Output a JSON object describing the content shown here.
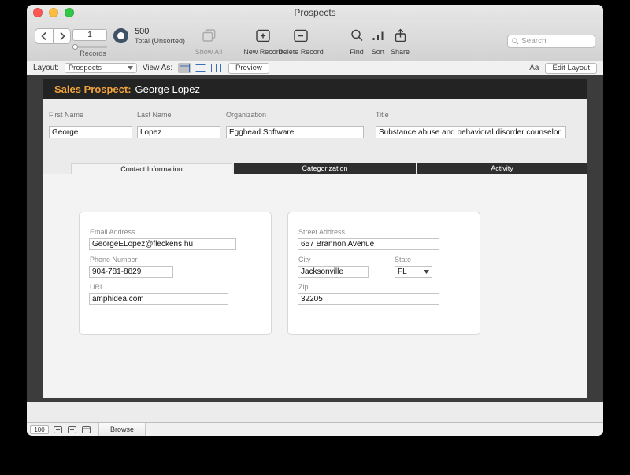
{
  "window": {
    "title": "Prospects"
  },
  "toolbar": {
    "current_record": "1",
    "total_count": "500",
    "total_label": "Total (Unsorted)",
    "records_label": "Records",
    "buttons": {
      "show_all": "Show All",
      "new_record": "New Record",
      "delete_record": "Delete Record",
      "find": "Find",
      "sort": "Sort",
      "share": "Share"
    },
    "search_placeholder": "Search"
  },
  "layout_bar": {
    "layout_label": "Layout:",
    "layout_value": "Prospects",
    "view_as_label": "View As:",
    "preview_label": "Preview",
    "font_toggle": "Aa",
    "edit_layout_label": "Edit Layout"
  },
  "record_header": {
    "prefix": "Sales Prospect:",
    "name": "George Lopez"
  },
  "form": {
    "first_name": {
      "label": "First Name",
      "value": "George"
    },
    "last_name": {
      "label": "Last Name",
      "value": "Lopez"
    },
    "organization": {
      "label": "Organization",
      "value": "Egghead Software"
    },
    "title": {
      "label": "Title",
      "value": "Substance abuse and behavioral disorder counselor"
    }
  },
  "tabs": [
    {
      "label": "Contact Information",
      "active": true
    },
    {
      "label": "Categorization",
      "active": false
    },
    {
      "label": "Activity",
      "active": false
    }
  ],
  "contact_card": {
    "email": {
      "label": "Email Address",
      "value": "GeorgeELopez@fleckens.hu"
    },
    "phone": {
      "label": "Phone Number",
      "value": "904-781-8829"
    },
    "url": {
      "label": "URL",
      "value": "amphidea.com"
    }
  },
  "address_card": {
    "street": {
      "label": "Street Address",
      "value": "657 Brannon Avenue"
    },
    "city": {
      "label": "City",
      "value": "Jacksonville"
    },
    "state": {
      "label": "State",
      "value": "FL"
    },
    "zip": {
      "label": "Zip",
      "value": "32205"
    }
  },
  "status_bar": {
    "zoom": "100",
    "mode": "Browse"
  },
  "icons": {
    "nav_back": "chevron-left",
    "nav_forward": "chevron-right",
    "found_set": "ring",
    "show_all": "stacked-records",
    "new_record": "plus-box",
    "delete_record": "minus-box",
    "find": "magnifier",
    "sort": "ascending-bars",
    "share": "box-arrow-up",
    "search": "magnifier",
    "view_form": "form-rect",
    "view_list": "list-lines",
    "view_table": "grid",
    "dropdown": "chevron-down"
  },
  "colors": {
    "accent_orange": "#F2A33C",
    "band_bg": "#232323",
    "content_bg": "#3C3C3C",
    "inactive_tab_bg": "#2E2E2E"
  }
}
